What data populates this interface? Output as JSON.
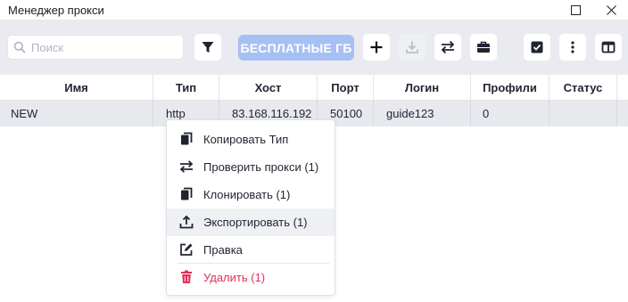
{
  "window": {
    "title": "Менеджер прокси"
  },
  "toolbar": {
    "search_placeholder": "Поиск",
    "search_value": "",
    "free_gb_label": "БЕСПЛАТНЫЕ ГБ",
    "accent_color": "#a7c0f4"
  },
  "table": {
    "columns": [
      "Имя",
      "Тип",
      "Хост",
      "Порт",
      "Логин",
      "Профили",
      "Статус"
    ],
    "rows": [
      {
        "name": "NEW",
        "type": "http",
        "host": "83.168.116.192",
        "port": "50100",
        "login": "guide123",
        "profiles": "0",
        "status": ""
      }
    ]
  },
  "context_menu": {
    "items": [
      {
        "label": "Копировать Тип",
        "icon": "copy-icon"
      },
      {
        "label": "Проверить прокси (1)",
        "icon": "swap-arrows-icon"
      },
      {
        "label": "Клонировать (1)",
        "icon": "clone-icon"
      },
      {
        "label": "Экспортировать (1)",
        "icon": "upload-icon"
      },
      {
        "label": "Правка",
        "icon": "edit-icon"
      },
      {
        "label": "Удалить (1)",
        "icon": "trash-icon"
      }
    ],
    "danger_color": "#e0305a"
  }
}
